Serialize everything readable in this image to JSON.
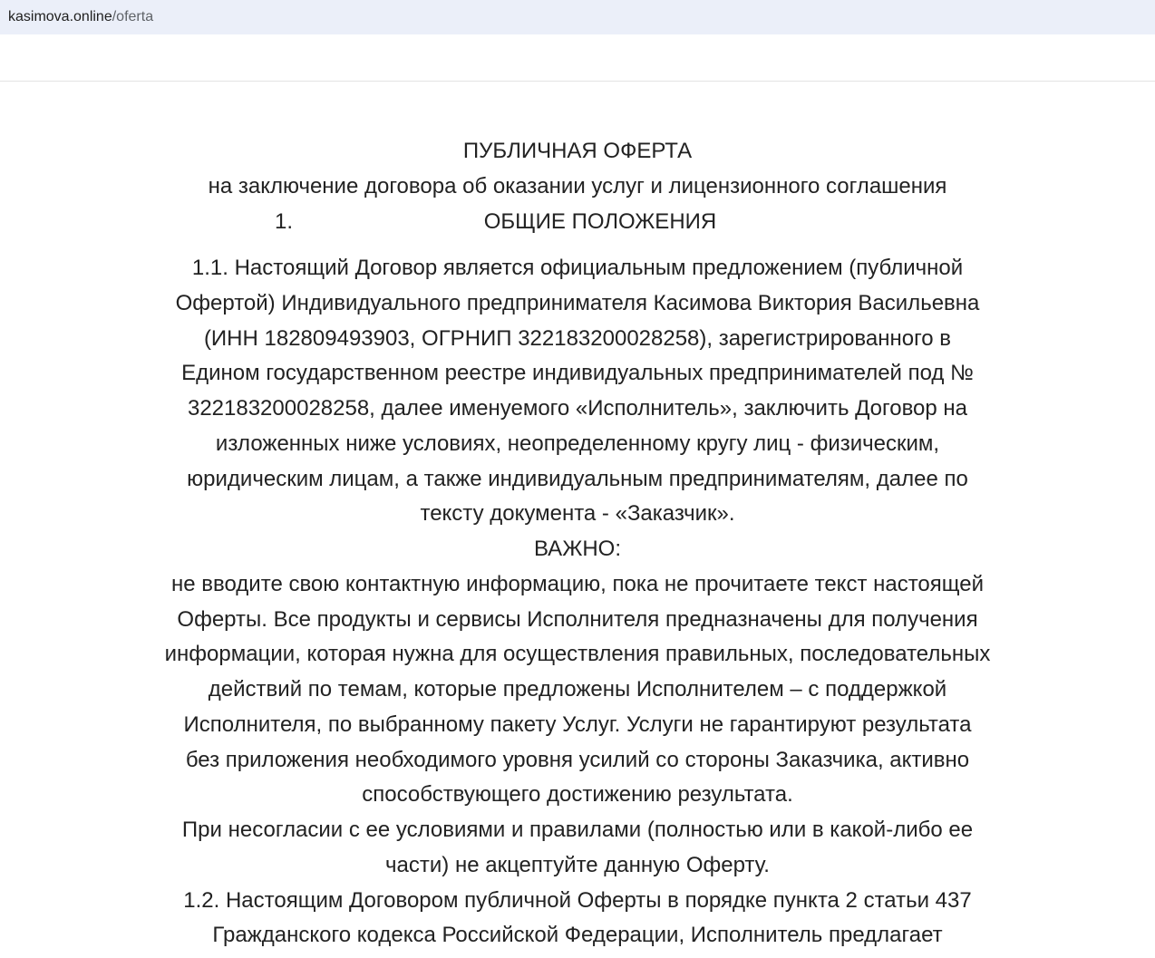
{
  "browser": {
    "url_domain": "kasimova.online",
    "url_path": "/oferta"
  },
  "document": {
    "title": "ПУБЛИЧНАЯ ОФЕРТА",
    "subtitle": "на заключение договора об оказании услуг и лицензионного соглашения",
    "section_number": "1.",
    "section_title": "ОБЩИЕ ПОЛОЖЕНИЯ",
    "lines": [
      "1.1. Настоящий Договор является официальным предложением (публичной",
      "Офертой) Индивидуального предпринимателя Касимова Виктория Васильевна",
      "(ИНН 182809493903, ОГРНИП 322183200028258), зарегистрированного в",
      "Едином государственном реестре индивидуальных предпринимателей под №",
      "322183200028258, далее именуемого «Исполнитель», заключить Договор на",
      "изложенных ниже условиях, неопределенному кругу лиц - физическим,",
      "юридическим лицам, а также индивидуальным предпринимателям, далее по",
      "тексту документа - «Заказчик».",
      "ВАЖНО:",
      "не вводите свою контактную информацию, пока не прочитаете текст настоящей",
      "Оферты. Все продукты и сервисы Исполнителя предназначены для получения",
      "информации, которая нужна для осуществления правильных, последовательных",
      "действий по темам, которые предложены Исполнителем – с поддержкой",
      "Исполнителя, по выбранному пакету Услуг. Услуги не гарантируют результата",
      "без приложения необходимого уровня усилий со стороны Заказчика, активно",
      "способствующего достижению результата.",
      "При несогласии с ее условиями и правилами (полностью или в какой-либо ее",
      "части) не акцептуйте данную Оферту.",
      "1.2. Настоящим Договором публичной Оферты в порядке пункта 2 статьи 437",
      "Гражданского кодекса Российской Федерации, Исполнитель предлагает"
    ]
  }
}
